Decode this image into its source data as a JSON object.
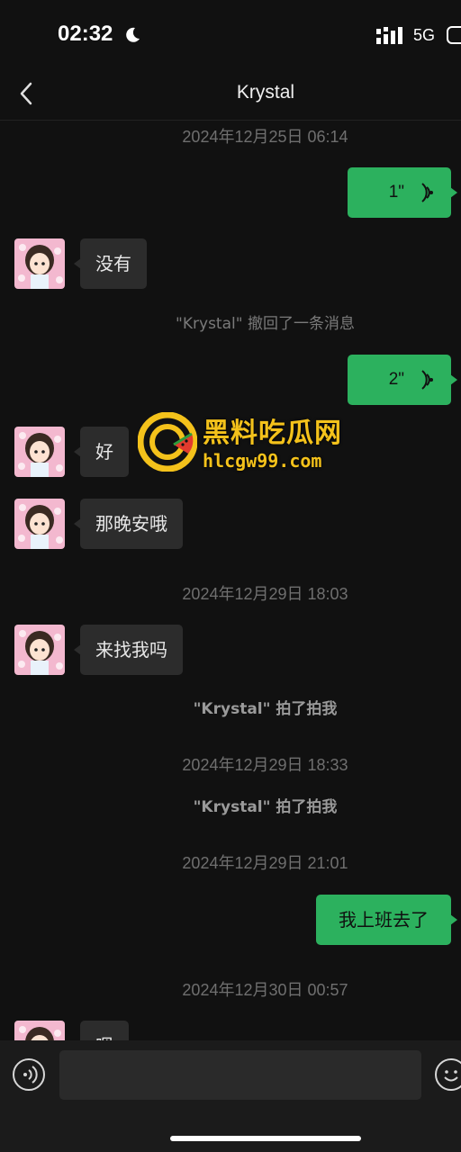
{
  "status_bar": {
    "time": "02:32",
    "network": "5G"
  },
  "nav": {
    "title": "Krystal"
  },
  "messages": {
    "ts1": "2024年12月25日 06:14",
    "voice1": "1\"",
    "in1": "没有",
    "recall": "\"Krystal\" 撤回了一条消息",
    "voice2": "2\"",
    "in2": "好",
    "in3": "那晚安哦",
    "ts2": "2024年12月29日 18:03",
    "in4": "来找我吗",
    "pat1": "\"Krystal\" 拍了拍我",
    "ts3": "2024年12月29日 18:33",
    "pat2": "\"Krystal\" 拍了拍我",
    "ts4": "2024年12月29日 21:01",
    "out1": "我上班去了",
    "ts5": "2024年12月30日 00:57",
    "in5": "嗯"
  },
  "watermark": {
    "title": "黑料吃瓜网",
    "url": "hlcgw99.com"
  },
  "input": {
    "placeholder": ""
  },
  "colors": {
    "background": "#111111",
    "bubble_out": "#2cb15e",
    "bubble_in": "#2c2c2c",
    "watermark": "#f4c21b"
  }
}
